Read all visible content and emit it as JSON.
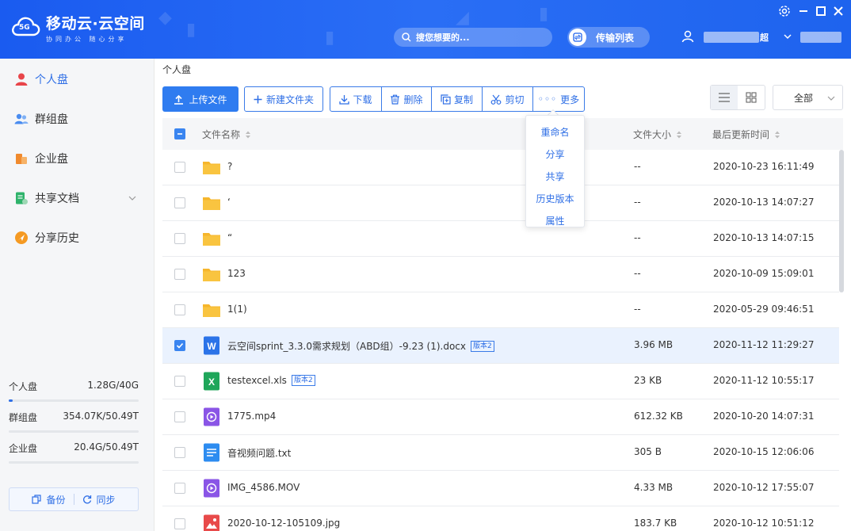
{
  "app": {
    "logo_title": "移动云·云空间",
    "logo_sub": "协同办公 随心分享",
    "logo_badge": "5G",
    "search_placeholder": "搜您想要的...",
    "transfer_label": "传输列表",
    "user_name_tail": "超"
  },
  "sidebar": {
    "items": [
      {
        "label": "个人盘",
        "icon": "person-icon",
        "active": true
      },
      {
        "label": "群组盘",
        "icon": "group-icon",
        "active": false
      },
      {
        "label": "企业盘",
        "icon": "enterprise-icon",
        "active": false
      },
      {
        "label": "共享文档",
        "icon": "shared-doc-icon",
        "active": false
      },
      {
        "label": "分享历史",
        "icon": "share-history-icon",
        "active": false
      }
    ],
    "usage": [
      {
        "label": "个人盘",
        "value": "1.28G/40G",
        "fraction": 0.032
      },
      {
        "label": "群组盘",
        "value": "354.07K/50.49T",
        "fraction": 0.0
      },
      {
        "label": "企业盘",
        "value": "20.4G/50.49T",
        "fraction": 0.0
      }
    ],
    "backup_label": "备份",
    "sync_label": "同步"
  },
  "main": {
    "breadcrumb": "个人盘",
    "upload_label": "上传文件",
    "new_folder_label": "新建文件夹",
    "actions": [
      "下载",
      "删除",
      "复制",
      "剪切",
      "更多"
    ],
    "filter_value": "全部",
    "columns": {
      "name": "文件名称",
      "size": "文件大小",
      "date": "最后更新时间"
    },
    "more_menu": [
      "重命名",
      "分享",
      "共享",
      "历史版本",
      "属性"
    ],
    "files": [
      {
        "name": "?",
        "type": "folder",
        "size": "--",
        "date": "2020-10-23 16:11:49",
        "badge": "",
        "selected": false
      },
      {
        "name": "‘",
        "type": "folder",
        "size": "--",
        "date": "2020-10-13 14:07:27",
        "badge": "",
        "selected": false
      },
      {
        "name": "“",
        "type": "folder",
        "size": "--",
        "date": "2020-10-13 14:07:15",
        "badge": "",
        "selected": false
      },
      {
        "name": "123",
        "type": "folder",
        "size": "--",
        "date": "2020-10-09 15:09:01",
        "badge": "",
        "selected": false
      },
      {
        "name": "1(1)",
        "type": "folder",
        "size": "--",
        "date": "2020-05-29 09:46:51",
        "badge": "",
        "selected": false
      },
      {
        "name": "云空间sprint_3.3.0需求规划（ABD组）-9.23 (1).docx",
        "type": "word",
        "size": "3.96 MB",
        "date": "2020-11-12 11:29:27",
        "badge": "版本2",
        "selected": true
      },
      {
        "name": "testexcel.xls",
        "type": "excel",
        "size": "23 KB",
        "date": "2020-11-12 10:55:17",
        "badge": "版本2",
        "selected": false
      },
      {
        "name": "1775.mp4",
        "type": "video",
        "size": "612.32 KB",
        "date": "2020-10-20 14:07:31",
        "badge": "",
        "selected": false
      },
      {
        "name": "音视频问题.txt",
        "type": "text",
        "size": "305 B",
        "date": "2020-10-15 12:06:06",
        "badge": "",
        "selected": false
      },
      {
        "name": "IMG_4586.MOV",
        "type": "video",
        "size": "4.33 MB",
        "date": "2020-10-12 17:55:07",
        "badge": "",
        "selected": false
      },
      {
        "name": "2020-10-12-105109.jpg",
        "type": "image",
        "size": "183.7 KB",
        "date": "2020-10-12 10:51:12",
        "badge": "",
        "selected": false
      }
    ]
  },
  "colors": {
    "accent": "#2f6fe6",
    "header": "#1e63ee",
    "folder": "#f9c440",
    "word": "#2b73e8",
    "excel": "#1fa65a",
    "video": "#8a55e6",
    "text": "#2d8cf0",
    "image": "#e84a4a"
  }
}
